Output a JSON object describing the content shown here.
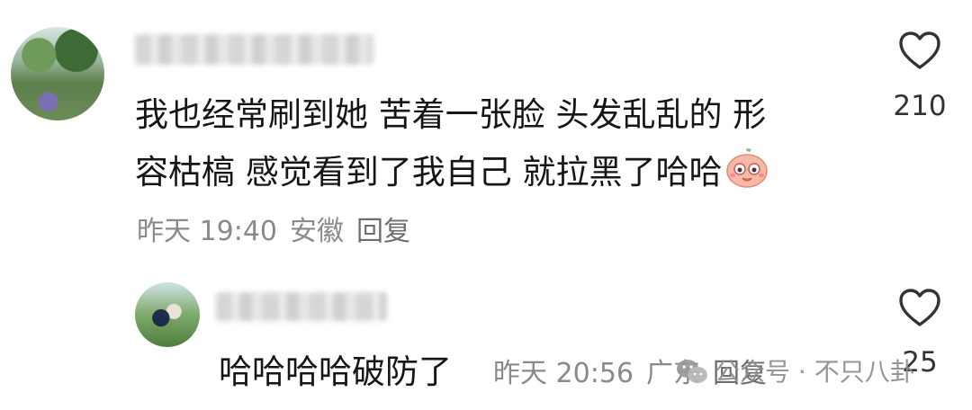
{
  "comments": [
    {
      "text_line1": "我也经常刷到她 苦着一张脸 头发乱乱的 形",
      "text_line2": "容枯槁 感觉看到了我自己 就拉黑了哈哈",
      "emoji": "smiling-face-emoji",
      "time": "昨天 19:40",
      "location": "安徽",
      "reply_label": "回复",
      "likes": "210"
    }
  ],
  "reply": {
    "text": "哈哈哈哈破防了",
    "time": "昨天 20:56",
    "location": "广东",
    "reply_label": "回复",
    "likes": "25"
  },
  "watermark": {
    "text": "公众号 · 不只八卦",
    "icon": "wechat-icon"
  },
  "colors": {
    "text": "#161616",
    "meta": "#8a8a8a",
    "heart_stroke": "#333333"
  }
}
